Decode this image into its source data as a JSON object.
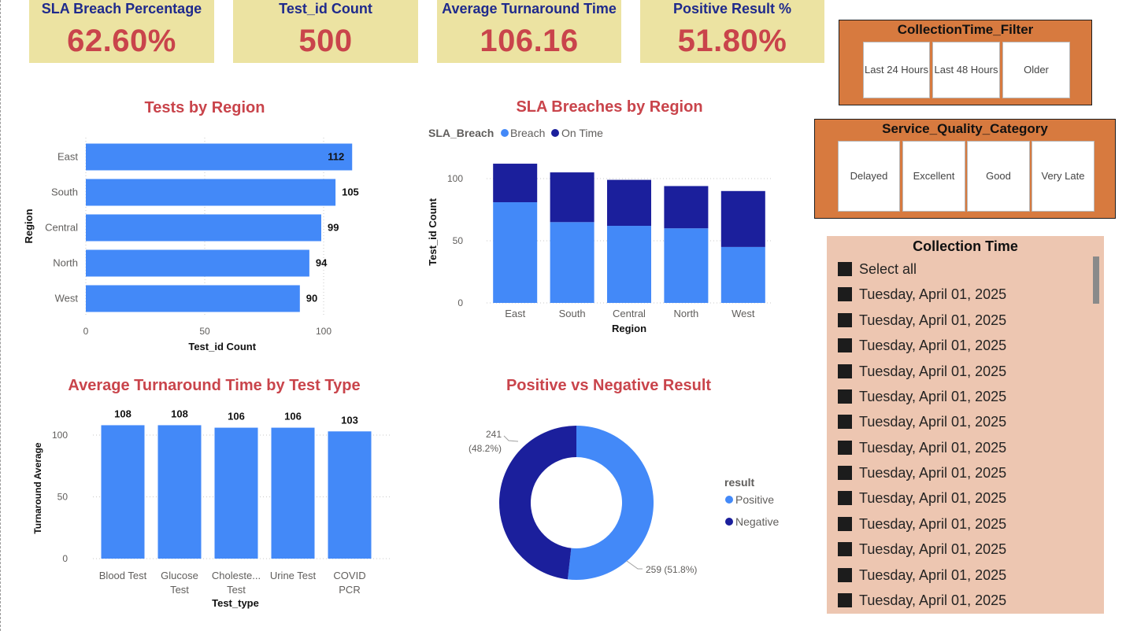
{
  "kpis": [
    {
      "title": "SLA Breach Percentage",
      "value": "62.60%"
    },
    {
      "title": "Test_id Count",
      "value": "500"
    },
    {
      "title": "Average Turnaround Time",
      "value": "106.16"
    },
    {
      "title": "Positive Result %",
      "value": "51.80%"
    }
  ],
  "colors": {
    "kpi_bg": "#ECE3A2",
    "kpi_title": "#1F2A8C",
    "kpi_value": "#C9444B",
    "chart_title": "#C9444B",
    "light_blue": "#4389F8",
    "dark_blue": "#1B1F9C",
    "slicer_bg": "#D77A3F",
    "list_bg": "#EDC6B1"
  },
  "collection_time_filter": {
    "title": "CollectionTime_Filter",
    "options": [
      "Last 24 Hours",
      "Last 48 Hours",
      "Older"
    ]
  },
  "service_quality": {
    "title": "Service_Quality_Category",
    "options": [
      "Delayed",
      "Excellent",
      "Good",
      "Very Late"
    ]
  },
  "collection_time": {
    "title": "Collection Time",
    "items": [
      "Select all",
      "Tuesday, April 01, 2025",
      "Tuesday, April 01, 2025",
      "Tuesday, April 01, 2025",
      "Tuesday, April 01, 2025",
      "Tuesday, April 01, 2025",
      "Tuesday, April 01, 2025",
      "Tuesday, April 01, 2025",
      "Tuesday, April 01, 2025",
      "Tuesday, April 01, 2025",
      "Tuesday, April 01, 2025",
      "Tuesday, April 01, 2025",
      "Tuesday, April 01, 2025",
      "Tuesday, April 01, 2025"
    ]
  },
  "chart_data": [
    {
      "id": "tests_by_region",
      "type": "bar",
      "orientation": "horizontal",
      "title": "Tests by Region",
      "xlabel": "Test_id Count",
      "ylabel": "Region",
      "categories": [
        "East",
        "South",
        "Central",
        "North",
        "West"
      ],
      "values": [
        112,
        105,
        99,
        94,
        90
      ],
      "xlim": [
        0,
        120
      ],
      "xticks": [
        0,
        50,
        100
      ],
      "data_labels": true,
      "grid": true
    },
    {
      "id": "sla_breaches_by_region",
      "type": "bar",
      "stacked": true,
      "title": "SLA Breaches by Region",
      "legend_title": "SLA_Breach",
      "legend_position": "top-left",
      "xlabel": "Region",
      "ylabel": "Test_id Count",
      "categories": [
        "East",
        "South",
        "Central",
        "North",
        "West"
      ],
      "series": [
        {
          "name": "Breach",
          "color": "#4389F8",
          "values": [
            81,
            65,
            62,
            60,
            45
          ]
        },
        {
          "name": "On Time",
          "color": "#1B1F9C",
          "values": [
            31,
            40,
            37,
            34,
            45
          ]
        }
      ],
      "ylim": [
        0,
        115
      ],
      "yticks": [
        0,
        50,
        100
      ],
      "grid": true
    },
    {
      "id": "avg_turnaround_by_test_type",
      "type": "bar",
      "title": "Average Turnaround Time by Test Type",
      "xlabel": "Test_type",
      "ylabel": "Turnaround Average",
      "categories": [
        "Blood Test",
        "Glucose Test",
        "Choleste... Test",
        "Urine Test",
        "COVID PCR"
      ],
      "values": [
        108,
        108,
        106,
        106,
        103
      ],
      "ylim": [
        0,
        118
      ],
      "yticks": [
        0,
        50,
        100
      ],
      "data_labels": true,
      "grid": true
    },
    {
      "id": "positive_vs_negative",
      "type": "pie",
      "donut": true,
      "title": "Positive vs Negative Result",
      "legend_title": "result",
      "legend_position": "right",
      "slices": [
        {
          "name": "Positive",
          "value": 259,
          "percent": "51.8%",
          "label": "259 (51.8%)",
          "color": "#4389F8"
        },
        {
          "name": "Negative",
          "value": 241,
          "percent": "48.2%",
          "label_line1": "241",
          "label_line2": "(48.2%)",
          "color": "#1B1F9C"
        }
      ]
    }
  ]
}
